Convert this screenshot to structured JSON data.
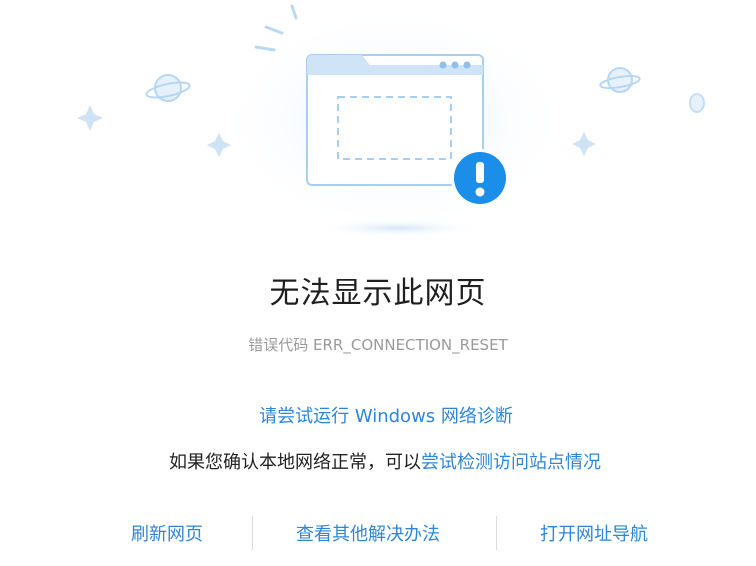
{
  "error_page": {
    "title": "无法显示此网页",
    "error_code": "错误代码 ERR_CONNECTION_RESET",
    "diagnose_link": "请尝试运行 Windows 网络诊断",
    "hint_prefix": "如果您确认本地网络正常，可以",
    "hint_link": "尝试检测访问站点情况"
  },
  "actions": [
    {
      "label": "刷新网页"
    },
    {
      "label": "查看其他解决办法"
    },
    {
      "label": "打开网址导航"
    }
  ],
  "colors": {
    "link": "#2f86d6",
    "title": "#1f1f1f",
    "muted": "#9a9a9a",
    "alert_badge": "#1a8ee8",
    "illustration_stroke": "#a9cff0"
  },
  "icons": [
    "planet-icon",
    "sparkle-icon",
    "browser-window-illustration",
    "alert-badge-icon"
  ]
}
